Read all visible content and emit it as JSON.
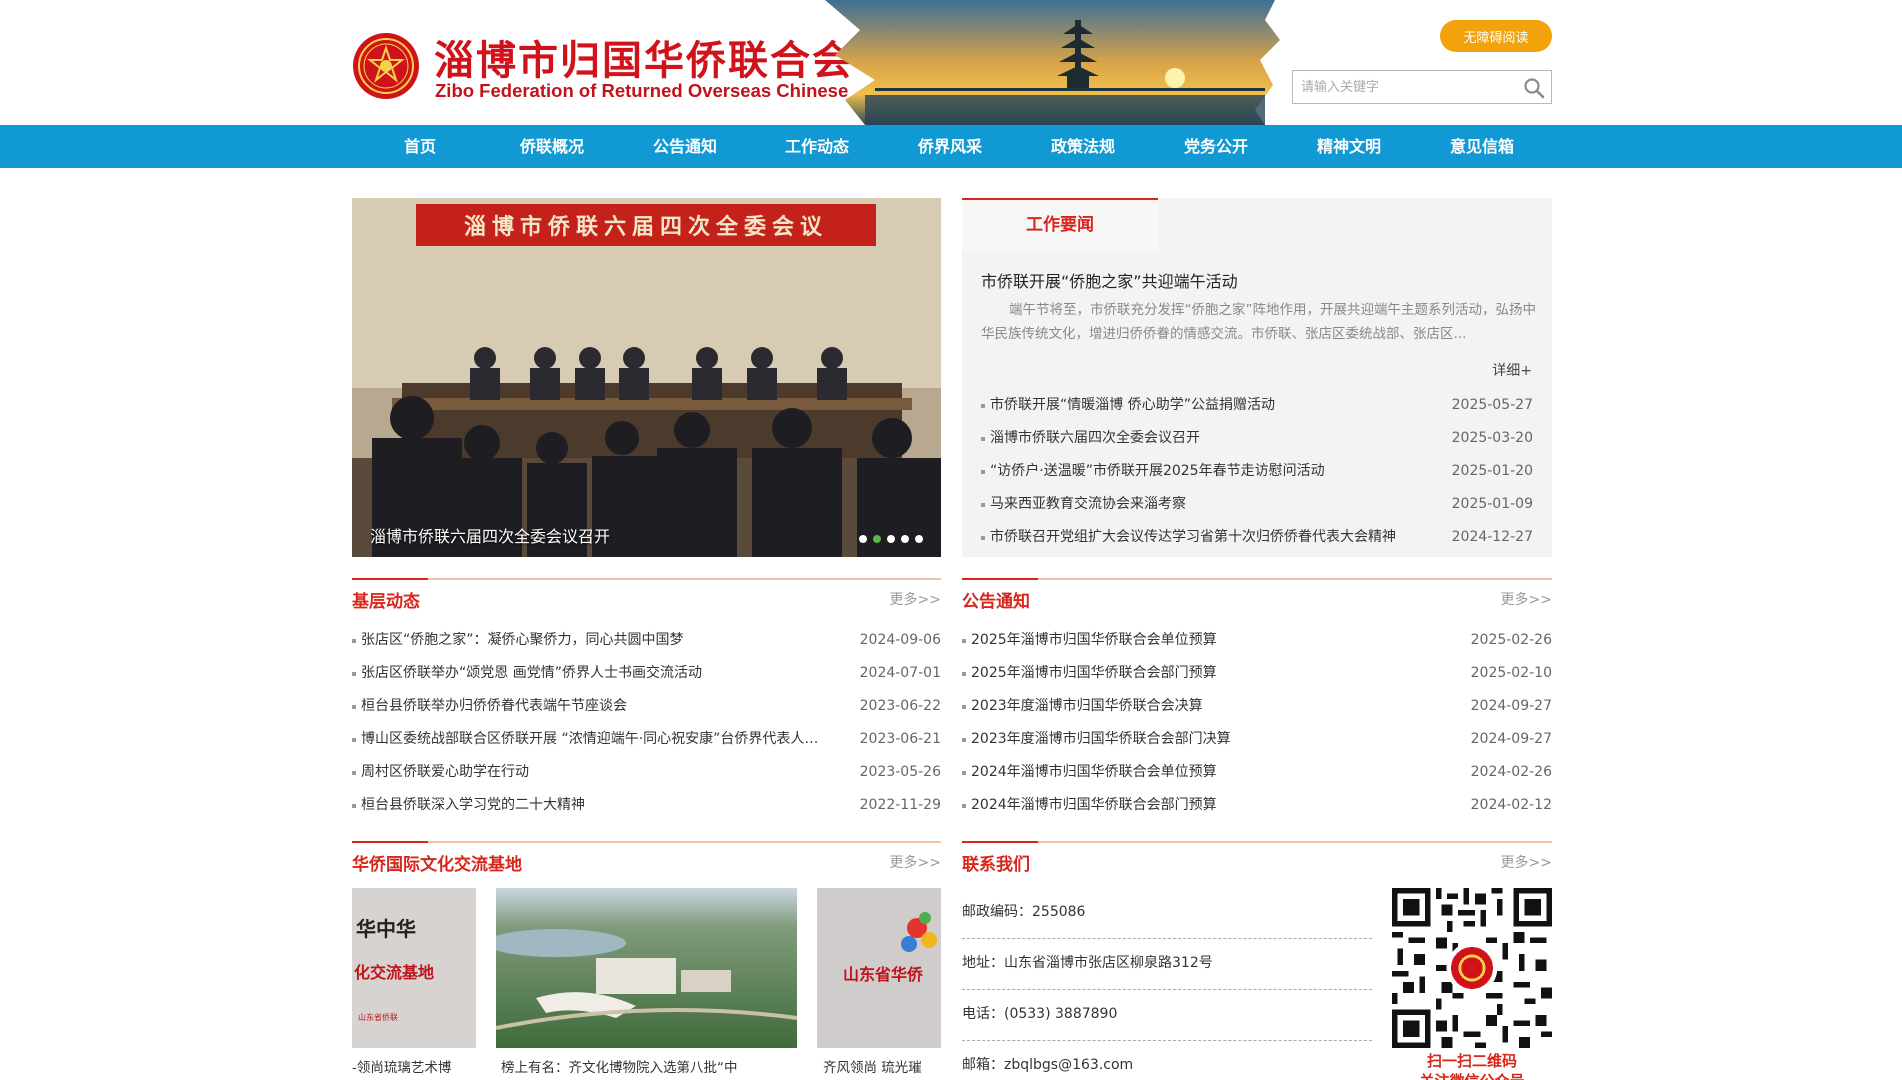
{
  "header": {
    "title": "淄博市归国华侨联合会",
    "subtitle": "Zibo Federation of Returned Overseas Chinese",
    "accessibility_button": "无障碍阅读",
    "search_placeholder": "请输入关键字"
  },
  "nav": [
    "首页",
    "侨联概况",
    "公告通知",
    "工作动态",
    "侨界风采",
    "政策法规",
    "党务公开",
    "精神文明",
    "意见信箱"
  ],
  "slider": {
    "banner_text": "淄博市侨联六届四次全委会议",
    "caption": "淄博市侨联六届四次全委会议召开",
    "dot_count": 5,
    "active_dot": 2
  },
  "work_news": {
    "tab": "工作要闻",
    "headline": "市侨联开展“侨胞之家”共迎端午活动",
    "summary": "端午节将至，市侨联充分发挥“侨胞之家”阵地作用，开展共迎端午主题系列活动，弘扬中华民族传统文化，增进归侨侨眷的情感交流。市侨联、张店区委统战部、张店区...",
    "more": "详细+",
    "items": [
      {
        "title": "市侨联开展“情暖淄博 侨心助学”公益捐赠活动",
        "date": "2025-05-27"
      },
      {
        "title": "淄博市侨联六届四次全委会议召开",
        "date": "2025-03-20"
      },
      {
        "title": "“访侨户·送温暖”市侨联开展2025年春节走访慰问活动",
        "date": "2025-01-20"
      },
      {
        "title": "马来西亚教育交流协会来淄考察",
        "date": "2025-01-09"
      },
      {
        "title": "市侨联召开党组扩大会议传达学习省第十次归侨侨眷代表大会精神",
        "date": "2024-12-27"
      }
    ]
  },
  "grassroots": {
    "title": "基层动态",
    "more": "更多>>",
    "items": [
      {
        "title": "张店区“侨胞之家”：凝侨心聚侨力，同心共圆中国梦",
        "date": "2024-09-06"
      },
      {
        "title": "张店区侨联举办“颂党恩 画党情”侨界人士书画交流活动",
        "date": "2024-07-01"
      },
      {
        "title": "桓台县侨联举办归侨侨眷代表端午节座谈会",
        "date": "2023-06-22"
      },
      {
        "title": "博山区委统战部联合区侨联开展 “浓情迎端午·同心祝安康”台侨界代表人士端午节联谊活动",
        "date": "2023-06-21"
      },
      {
        "title": "周村区侨联爱心助学在行动",
        "date": "2023-05-26"
      },
      {
        "title": "桓台县侨联深入学习党的二十大精神",
        "date": "2022-11-29"
      }
    ]
  },
  "notices": {
    "title": "公告通知",
    "more": "更多>>",
    "items": [
      {
        "title": "2025年淄博市归国华侨联合会单位预算",
        "date": "2025-02-26"
      },
      {
        "title": "2025年淄博市归国华侨联合会部门预算",
        "date": "2025-02-10"
      },
      {
        "title": "2023年度淄博市归国华侨联合会决算",
        "date": "2024-09-27"
      },
      {
        "title": "2023年度淄博市归国华侨联合会部门决算",
        "date": "2024-09-27"
      },
      {
        "title": "2024年淄博市归国华侨联合会单位预算",
        "date": "2024-02-26"
      },
      {
        "title": "2024年淄博市归国华侨联合会部门预算",
        "date": "2024-02-12"
      }
    ]
  },
  "bases": {
    "title": "华侨国际文化交流基地",
    "more": "更多>>",
    "items": [
      {
        "caption": "-领尚琉璃艺术博",
        "img_text_1": "华中华",
        "img_text_2": "化交流基地",
        "img_text_3": "山东省侨联"
      },
      {
        "caption": "榜上有名：齐文化博物院入选第八批“中"
      },
      {
        "caption": "齐风领尚 琉光璀",
        "img_text_1": "山东省华侨"
      }
    ]
  },
  "contact": {
    "title": "联系我们",
    "more": "更多>>",
    "rows": [
      "邮政编码：255086",
      "地址：山东省淄博市张店区柳泉路312号",
      "电话：(0533) 3887890",
      "邮箱：zbqlbgs@163.com"
    ],
    "qr_line1": "扫一扫二维码",
    "qr_line2": "关注微信公众号"
  },
  "colors": {
    "nav": "#1199d4",
    "accent_red": "#d7261b",
    "button_orange": "#f2a20b",
    "section_line": "#f1c3a2"
  },
  "icons": [
    "logo-emblem",
    "search-icon"
  ]
}
